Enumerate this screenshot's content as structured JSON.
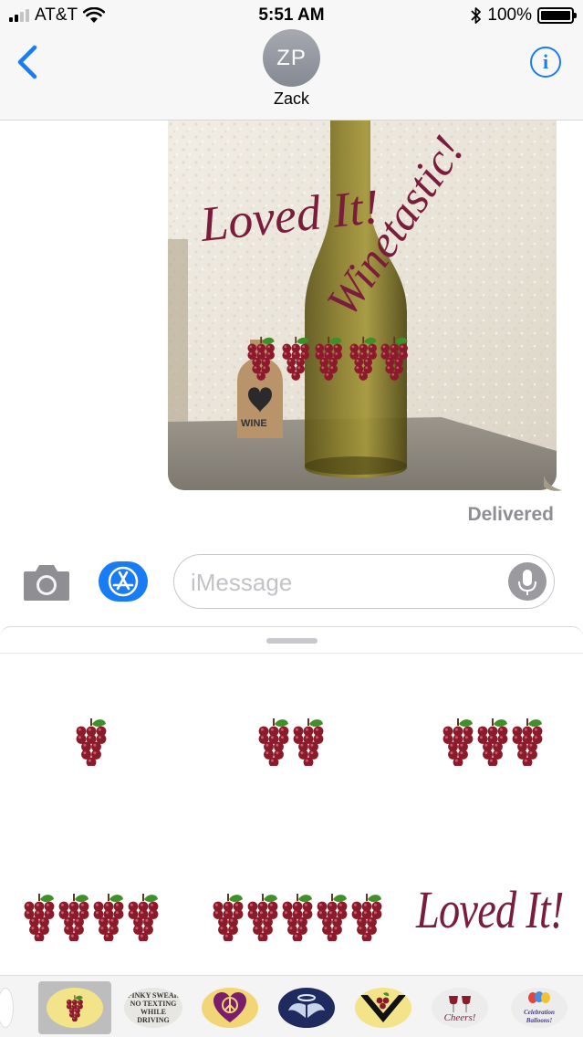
{
  "status_bar": {
    "carrier": "AT&T",
    "time": "5:51 AM",
    "battery_percent": "100%",
    "battery_level": 1.0,
    "signal_bars": 2,
    "icons": [
      "signal-icon",
      "wifi-icon",
      "bluetooth-icon",
      "battery-icon"
    ]
  },
  "header": {
    "back_icon": "chevron-left-icon",
    "avatar_initials": "ZP",
    "contact_name": "Zack",
    "info_icon": "info-icon",
    "info_glyph": "i"
  },
  "conversation": {
    "photo_overlay": {
      "loved_text": "Loved It!",
      "winetastic_text": "Winetastic!",
      "tag_text": "WINE"
    },
    "status": "Delivered"
  },
  "compose": {
    "placeholder": "iMessage",
    "value": "",
    "icons": [
      "camera-icon",
      "app-store-icon",
      "microphone-icon"
    ]
  },
  "sticker_drawer": {
    "stickers": [
      {
        "name": "grapes-1",
        "count": 1
      },
      {
        "name": "grapes-2",
        "count": 2
      },
      {
        "name": "grapes-3",
        "count": 3
      },
      {
        "name": "grapes-4",
        "count": 4
      },
      {
        "name": "grapes-5",
        "count": 5
      },
      {
        "name": "loved-it",
        "text": "Loved It!"
      }
    ]
  },
  "app_tray": {
    "items": [
      {
        "name": "grapes-pack",
        "selected": true
      },
      {
        "name": "pinky-swear-pack",
        "text": "PINKY SWEAR NO TEXTING WHILE DRIVING"
      },
      {
        "name": "peace-heart-pack"
      },
      {
        "name": "wings-pack"
      },
      {
        "name": "grape-v-pack"
      },
      {
        "name": "cheers-pack",
        "text": "Cheers!"
      },
      {
        "name": "celebration-pack",
        "text": "Celebration Balloons!"
      }
    ]
  },
  "colors": {
    "accent": "#1a7cf5",
    "grape": "#8b1a2b",
    "leaf": "#3f8f2a",
    "script_text": "#7a1d3c"
  }
}
